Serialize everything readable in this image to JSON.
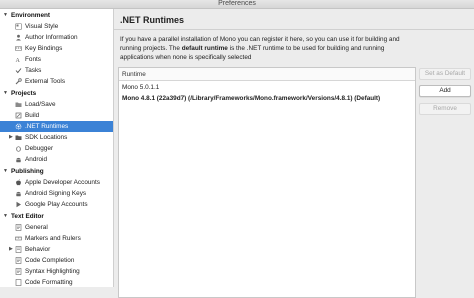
{
  "window": {
    "title": "Preferences"
  },
  "sidebar": {
    "categories": [
      {
        "label": "Environment",
        "items": [
          "Visual Style",
          "Author Information",
          "Key Bindings",
          "Fonts",
          "Tasks",
          "External Tools"
        ]
      },
      {
        "label": "Projects",
        "items": [
          "Load/Save",
          "Build",
          ".NET Runtimes",
          "SDK Locations",
          "Debugger",
          "Android"
        ]
      },
      {
        "label": "Publishing",
        "items": [
          "Apple Developer Accounts",
          "Android Signing Keys",
          "Google Play Accounts"
        ]
      },
      {
        "label": "Text Editor",
        "items": [
          "General",
          "Markers and Rulers",
          "Behavior",
          "Code Completion",
          "Syntax Highlighting",
          "Code Formatting"
        ]
      }
    ],
    "selected": ".NET Runtimes"
  },
  "main": {
    "title": ".NET Runtimes",
    "description_part1": "If you have a parallel installation of Mono you can register it here, so you can use it for building and running projects. The ",
    "description_bold": "default runtime",
    "description_part2": " is the .NET runtime to be used for building and running applications when none is specifically selected",
    "table": {
      "header": "Runtime",
      "rows": [
        {
          "label": "Mono 5.0.1.1",
          "default": false
        },
        {
          "label": "Mono 4.8.1 (22a39d7) (/Library/Frameworks/Mono.framework/Versions/4.8.1) (Default)",
          "default": true
        }
      ]
    },
    "buttons": {
      "set_default": "Set as Default",
      "add": "Add",
      "remove": "Remove"
    }
  },
  "colors": {
    "selection": "#3b82d6",
    "sidebar_bg": "#ffffff",
    "window_bg": "#ececec"
  }
}
